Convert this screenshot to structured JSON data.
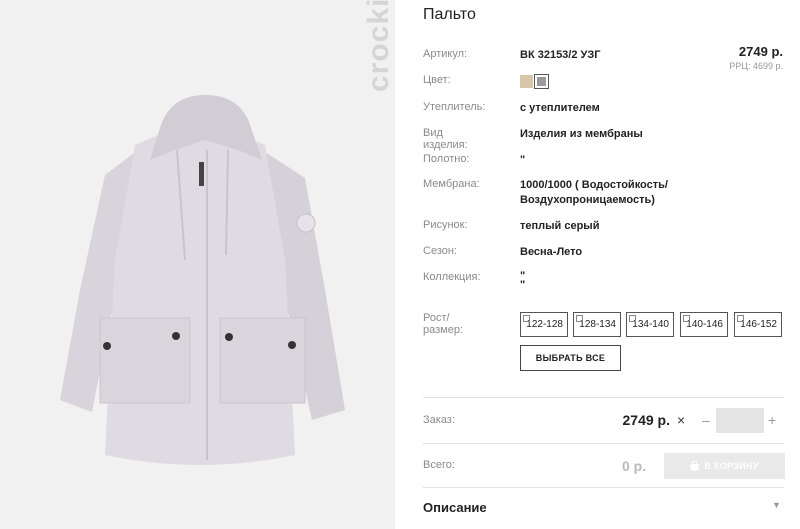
{
  "product": {
    "title": "Пальто",
    "brand": "crockid",
    "price": "2749 р.",
    "rrc": "РРЦ: 4699 р."
  },
  "attributes": [
    {
      "label": "Артикул:",
      "value": "ВК 32153/2 УЗГ"
    },
    {
      "label": "Цвет:",
      "value": ""
    },
    {
      "label": "Утеплитель:",
      "value": "с утеплителем"
    },
    {
      "label": "Вид изделия:",
      "value": "Изделия из мембраны"
    },
    {
      "label": "Полотно:",
      "value": "\""
    },
    {
      "label": "Мембрана:",
      "value": "1000/1000 ( Водостойкость/",
      "value2": "Воздухопроницаемость)"
    },
    {
      "label": "Рисунок:",
      "value": "теплый серый"
    },
    {
      "label": "Сезон:",
      "value": "Весна-Лето"
    },
    {
      "label": "Коллекция:",
      "value": "\"",
      "value2": "\""
    },
    {
      "label": "Рост/размер:",
      "value": ""
    }
  ],
  "colors": [
    "#d7c6a7",
    "#9a9a9a"
  ],
  "sizes": [
    "122-128",
    "128-134",
    "134-140",
    "140-146",
    "146-152"
  ],
  "select_all": "ВЫБРАТЬ ВСЕ",
  "order": {
    "label": "Заказ:",
    "total": "2749 р.",
    "times": "×",
    "minus": "–",
    "plus": "+",
    "qty_value": ""
  },
  "total": {
    "label": "Всего:",
    "value": "0 р.",
    "cart_button": "В КОРЗИНУ"
  },
  "description": {
    "label": "Описание",
    "arrow": "▼"
  }
}
